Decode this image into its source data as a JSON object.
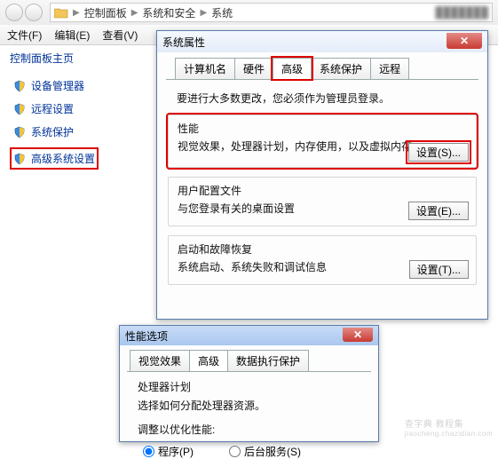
{
  "toolbar": {
    "crumbs": [
      "控制面板",
      "系统和安全",
      "系统"
    ],
    "blur": "███████"
  },
  "menubar": {
    "file": "文件(F)",
    "edit": "编辑(E)",
    "view": "查看(V)"
  },
  "sidebar": {
    "home": "控制面板主页",
    "items": [
      {
        "label": "设备管理器"
      },
      {
        "label": "远程设置"
      },
      {
        "label": "系统保护"
      },
      {
        "label": "高级系统设置"
      }
    ]
  },
  "dlg1": {
    "title": "系统属性",
    "tabs": {
      "t0": "计算机名",
      "t1": "硬件",
      "t2": "高级",
      "t3": "系统保护",
      "t4": "远程"
    },
    "note": "要进行大多数更改，您必须作为管理员登录。",
    "g1": {
      "title": "性能",
      "desc": "视觉效果，处理器计划，内存使用，以及虚拟内存",
      "btn": "设置(S)..."
    },
    "g2": {
      "title": "用户配置文件",
      "desc": "与您登录有关的桌面设置",
      "btn": "设置(E)..."
    },
    "g3": {
      "title": "启动和故障恢复",
      "desc": "系统启动、系统失败和调试信息",
      "btn": "设置(T)..."
    }
  },
  "dlg2": {
    "title": "性能选项",
    "tabs": {
      "t0": "视觉效果",
      "t1": "高级",
      "t2": "数据执行保护"
    },
    "sec_title": "处理器计划",
    "sec_desc": "选择如何分配处理器资源。",
    "adjust": "调整以优化性能:",
    "opt1": "程序(P)",
    "opt2": "后台服务(S)"
  },
  "watermark": {
    "l1": "查字典  教程集",
    "l2": "jiaocheng.chazidian.com"
  }
}
